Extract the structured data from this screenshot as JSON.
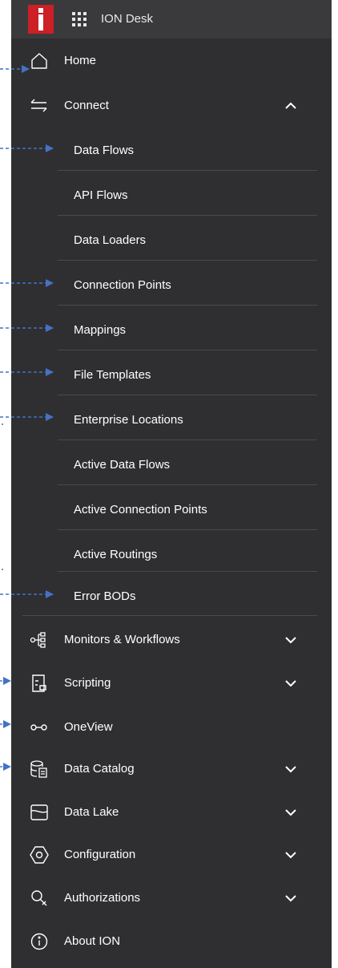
{
  "header": {
    "app_title": "ION Desk",
    "logo_letter": "i"
  },
  "nav": {
    "home": "Home",
    "connect": {
      "label": "Connect",
      "expanded": true,
      "children": [
        "Data Flows",
        "API Flows",
        "Data Loaders",
        "Connection Points",
        "Mappings",
        "File Templates",
        "Enterprise Locations",
        "Active Data Flows",
        "Active Connection Points",
        "Active Routings",
        "Error BODs"
      ]
    },
    "monitors": "Monitors & Workflows",
    "scripting": "Scripting",
    "oneview": "OneView",
    "data_catalog": "Data Catalog",
    "data_lake": "Data Lake",
    "configuration": "Configuration",
    "authorizations": "Authorizations",
    "about": "About ION"
  },
  "colors": {
    "panel_bg": "#2f2f31",
    "topbar_bg": "#3a3a3c",
    "logo_red": "#cc1f26",
    "annotation_blue": "#4472c4"
  }
}
